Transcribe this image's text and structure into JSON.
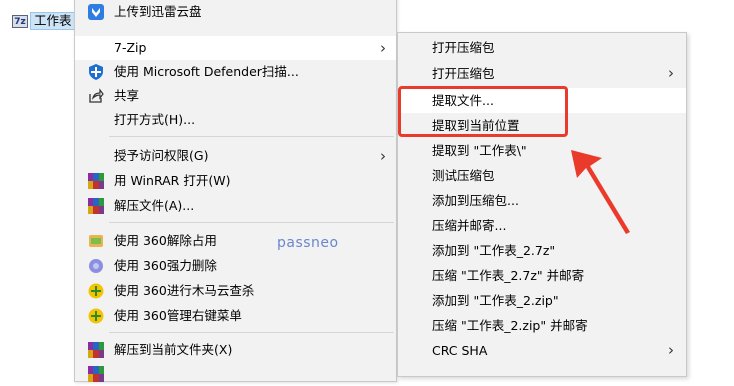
{
  "file_item": {
    "icon_text": "7z",
    "label": "工作表"
  },
  "main_menu": {
    "items": [
      {
        "label": "上传到迅雷云盘",
        "icon": "thunder-cloud-icon"
      },
      {
        "label": "7-Zip",
        "has_submenu": true,
        "highlighted": true
      },
      {
        "label": "使用 Microsoft Defender扫描...",
        "icon": "defender-shield-icon"
      },
      {
        "label": "共享",
        "icon": "share-icon"
      },
      {
        "label": "打开方式(H)..."
      },
      {
        "label": "授予访问权限(G)",
        "has_submenu": true
      },
      {
        "label": "用 WinRAR 打开(W)",
        "icon": "winrar-icon"
      },
      {
        "label": "解压文件(A)...",
        "icon": "winrar-icon"
      },
      {
        "label": "使用 360解除占用",
        "icon": "360-unlock-icon"
      },
      {
        "label": "使用 360强力删除",
        "icon": "360-delete-icon"
      },
      {
        "label": "使用 360进行木马云查杀",
        "icon": "360-scan-icon"
      },
      {
        "label": "使用 360管理右键菜单",
        "icon": "360-menu-icon"
      },
      {
        "label": "解压到当前文件夹(X)",
        "icon": "winrar-icon"
      }
    ]
  },
  "submenu": {
    "items": [
      {
        "label": "打开压缩包"
      },
      {
        "label": "打开压缩包",
        "has_submenu": true
      },
      {
        "label": "提取文件...",
        "highlighted": true
      },
      {
        "label": "提取到当前位置"
      },
      {
        "label": "提取到 \"工作表\\\""
      },
      {
        "label": "测试压缩包"
      },
      {
        "label": "添加到压缩包..."
      },
      {
        "label": "压缩并邮寄..."
      },
      {
        "label": "添加到 \"工作表_2.7z\""
      },
      {
        "label": "压缩 \"工作表_2.7z\" 并邮寄"
      },
      {
        "label": "添加到 \"工作表_2.zip\""
      },
      {
        "label": "压缩 \"工作表_2.zip\" 并邮寄"
      },
      {
        "label": "CRC SHA",
        "has_submenu": true
      }
    ]
  },
  "watermark": "passneo",
  "colors": {
    "annotation_red": "#ea3a2b",
    "menu_bg": "#f2f2f2",
    "watermark": "#6a87cc"
  }
}
